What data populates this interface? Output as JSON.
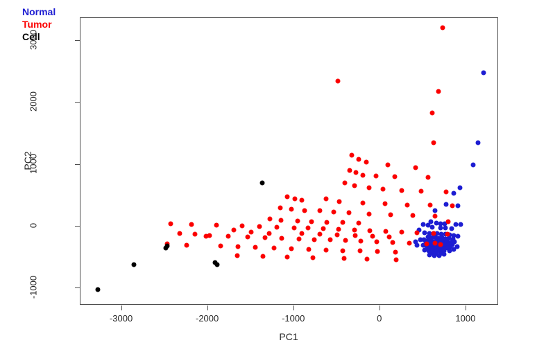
{
  "chart_data": {
    "type": "scatter",
    "title": "",
    "xlabel": "PC1",
    "ylabel": "PC2",
    "xlim": [
      -3480,
      1380
    ],
    "ylim": [
      -1280,
      3370
    ],
    "xticks": [
      -3000,
      -2000,
      -1000,
      0,
      1000
    ],
    "xticklabels": [
      "-3000",
      "-2000",
      "-1000",
      "0",
      "1000"
    ],
    "yticks": [
      -1000,
      0,
      1000,
      2000,
      3000
    ],
    "yticklabels": [
      "-1000",
      "0",
      "1000",
      "2000",
      "3000"
    ],
    "grid": false,
    "legend_position": "top-left",
    "legend": [
      {
        "label": "Normal",
        "color": "#1d1dd2"
      },
      {
        "label": "Tumor",
        "color": "#fb0000"
      },
      {
        "label": "Cell",
        "color": "#000000"
      }
    ],
    "series": [
      {
        "name": "Normal",
        "color": "#1d1dd2",
        "points": [
          [
            1205,
            2480
          ],
          [
            1140,
            1350
          ],
          [
            1085,
            990
          ],
          [
            925,
            620
          ],
          [
            860,
            530
          ],
          [
            770,
            360
          ],
          [
            905,
            330
          ],
          [
            640,
            260
          ],
          [
            590,
            80
          ],
          [
            655,
            50
          ],
          [
            700,
            45
          ],
          [
            755,
            40
          ],
          [
            880,
            35
          ],
          [
            935,
            30
          ],
          [
            505,
            30
          ],
          [
            560,
            20
          ],
          [
            610,
            -10
          ],
          [
            700,
            -20
          ],
          [
            760,
            -30
          ],
          [
            830,
            -40
          ],
          [
            455,
            -60
          ],
          [
            520,
            -100
          ],
          [
            575,
            -110
          ],
          [
            620,
            -120
          ],
          [
            665,
            -115
          ],
          [
            710,
            -130
          ],
          [
            760,
            -125
          ],
          [
            805,
            -140
          ],
          [
            860,
            -150
          ],
          [
            905,
            -160
          ],
          [
            560,
            -170
          ],
          [
            600,
            -180
          ],
          [
            640,
            -175
          ],
          [
            680,
            -190
          ],
          [
            720,
            -185
          ],
          [
            760,
            -200
          ],
          [
            800,
            -195
          ],
          [
            845,
            -205
          ],
          [
            470,
            -210
          ],
          [
            510,
            -215
          ],
          [
            555,
            -225
          ],
          [
            600,
            -230
          ],
          [
            645,
            -235
          ],
          [
            690,
            -240
          ],
          [
            730,
            -245
          ],
          [
            775,
            -250
          ],
          [
            820,
            -255
          ],
          [
            865,
            -245
          ],
          [
            530,
            -270
          ],
          [
            575,
            -275
          ],
          [
            620,
            -280
          ],
          [
            660,
            -285
          ],
          [
            705,
            -290
          ],
          [
            750,
            -295
          ],
          [
            795,
            -300
          ],
          [
            840,
            -290
          ],
          [
            500,
            -310
          ],
          [
            545,
            -320
          ],
          [
            590,
            -325
          ],
          [
            635,
            -330
          ],
          [
            680,
            -335
          ],
          [
            725,
            -340
          ],
          [
            770,
            -335
          ],
          [
            815,
            -330
          ],
          [
            555,
            -360
          ],
          [
            600,
            -365
          ],
          [
            645,
            -370
          ],
          [
            690,
            -365
          ],
          [
            735,
            -360
          ],
          [
            780,
            -355
          ],
          [
            520,
            -385
          ],
          [
            565,
            -395
          ],
          [
            610,
            -400
          ],
          [
            655,
            -405
          ],
          [
            700,
            -400
          ],
          [
            745,
            -390
          ],
          [
            600,
            -430
          ],
          [
            650,
            -445
          ],
          [
            700,
            -440
          ],
          [
            575,
            -465
          ],
          [
            630,
            -475
          ],
          [
            685,
            -470
          ],
          [
            740,
            -455
          ],
          [
            810,
            -400
          ],
          [
            855,
            -370
          ],
          [
            895,
            -330
          ],
          [
            415,
            -250
          ],
          [
            430,
            -310
          ]
        ]
      },
      {
        "name": "Tumor",
        "color": "#fb0000",
        "points": [
          [
            730,
            3210
          ],
          [
            -490,
            2350
          ],
          [
            680,
            2180
          ],
          [
            610,
            1840
          ],
          [
            620,
            1350
          ],
          [
            -330,
            1150
          ],
          [
            -245,
            1080
          ],
          [
            -160,
            1040
          ],
          [
            90,
            1000
          ],
          [
            415,
            950
          ],
          [
            -350,
            900
          ],
          [
            -280,
            870
          ],
          [
            -200,
            830
          ],
          [
            -50,
            810
          ],
          [
            170,
            800
          ],
          [
            560,
            790
          ],
          [
            -410,
            700
          ],
          [
            -300,
            660
          ],
          [
            -130,
            620
          ],
          [
            30,
            600
          ],
          [
            250,
            580
          ],
          [
            480,
            570
          ],
          [
            770,
            560
          ],
          [
            -1080,
            480
          ],
          [
            -990,
            450
          ],
          [
            -910,
            420
          ],
          [
            -630,
            440
          ],
          [
            -470,
            400
          ],
          [
            -200,
            380
          ],
          [
            60,
            370
          ],
          [
            320,
            350
          ],
          [
            580,
            340
          ],
          [
            840,
            330
          ],
          [
            -1160,
            300
          ],
          [
            -1030,
            280
          ],
          [
            -880,
            260
          ],
          [
            -700,
            250
          ],
          [
            -540,
            230
          ],
          [
            -360,
            220
          ],
          [
            -130,
            200
          ],
          [
            120,
            190
          ],
          [
            380,
            180
          ],
          [
            640,
            170
          ],
          [
            -1280,
            120
          ],
          [
            -1150,
            100
          ],
          [
            -960,
            90
          ],
          [
            -800,
            80
          ],
          [
            -620,
            70
          ],
          [
            -430,
            60
          ],
          [
            -250,
            50
          ],
          [
            -2430,
            40
          ],
          [
            -2190,
            30
          ],
          [
            -1900,
            20
          ],
          [
            -1600,
            10
          ],
          [
            -1400,
            0
          ],
          [
            -1200,
            -10
          ],
          [
            -1000,
            -20
          ],
          [
            -840,
            -30
          ],
          [
            -660,
            -40
          ],
          [
            -480,
            -50
          ],
          [
            -300,
            -60
          ],
          [
            -120,
            -70
          ],
          [
            70,
            -80
          ],
          [
            250,
            -90
          ],
          [
            430,
            -100
          ],
          [
            620,
            -120
          ],
          [
            780,
            -130
          ],
          [
            -2330,
            -120
          ],
          [
            -2150,
            -130
          ],
          [
            -1980,
            -150
          ],
          [
            -1760,
            -160
          ],
          [
            -1540,
            -170
          ],
          [
            -1340,
            -180
          ],
          [
            -1140,
            -190
          ],
          [
            -940,
            -200
          ],
          [
            -760,
            -210
          ],
          [
            -580,
            -220
          ],
          [
            -400,
            -230
          ],
          [
            -220,
            -240
          ],
          [
            -40,
            -250
          ],
          [
            150,
            -260
          ],
          [
            340,
            -270
          ],
          [
            540,
            -280
          ],
          [
            -2470,
            -280
          ],
          [
            -2250,
            -300
          ],
          [
            -1850,
            -320
          ],
          [
            -1650,
            -330
          ],
          [
            -1450,
            -340
          ],
          [
            -1230,
            -350
          ],
          [
            -1030,
            -360
          ],
          [
            -830,
            -370
          ],
          [
            -630,
            -380
          ],
          [
            -430,
            -390
          ],
          [
            -230,
            -400
          ],
          [
            -30,
            -410
          ],
          [
            180,
            -420
          ],
          [
            -1660,
            -470
          ],
          [
            -1360,
            -490
          ],
          [
            -1080,
            -500
          ],
          [
            -780,
            -510
          ],
          [
            -420,
            -520
          ],
          [
            -150,
            -530
          ],
          [
            190,
            -540
          ],
          [
            640,
            -270
          ],
          [
            700,
            -290
          ],
          [
            790,
            80
          ],
          [
            -2020,
            -160
          ],
          [
            -1700,
            -60
          ],
          [
            -1500,
            -90
          ],
          [
            -1290,
            -120
          ],
          [
            -905,
            -115
          ],
          [
            -700,
            -130
          ],
          [
            -500,
            -140
          ],
          [
            -290,
            -150
          ],
          [
            -90,
            -160
          ],
          [
            110,
            -170
          ]
        ]
      },
      {
        "name": "Cell",
        "color": "#000000",
        "points": [
          [
            -3280,
            -1020
          ],
          [
            -2860,
            -620
          ],
          [
            -2490,
            -350
          ],
          [
            -2470,
            -320
          ],
          [
            -1920,
            -580
          ],
          [
            -1890,
            -620
          ],
          [
            -1370,
            700
          ]
        ]
      }
    ]
  }
}
